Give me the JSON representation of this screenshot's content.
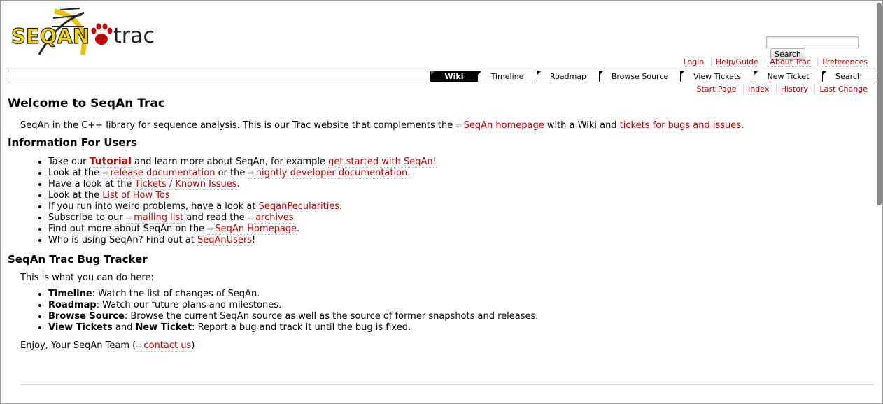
{
  "logo": {
    "text_seqan": "SEQAN",
    "text_trac": "trac"
  },
  "search": {
    "button_label": "Search",
    "placeholder": ""
  },
  "metanav": [
    "Login",
    "Help/Guide",
    "About Trac",
    "Preferences"
  ],
  "mainnav": [
    {
      "label": "Wiki",
      "active": true
    },
    {
      "label": "Timeline"
    },
    {
      "label": "Roadmap"
    },
    {
      "label": "Browse Source"
    },
    {
      "label": "View Tickets"
    },
    {
      "label": "New Ticket"
    },
    {
      "label": "Search"
    }
  ],
  "ctxtnav": [
    "Start Page",
    "Index",
    "History",
    "Last Change"
  ],
  "page": {
    "title": "Welcome to SeqAn Trac",
    "intro": {
      "t1": "SeqAn in the C++ library for sequence analysis. This is our Trac website that complements the ",
      "link1": "SeqAn homepage",
      "t2": " with a Wiki and ",
      "link2": "tickets for bugs and issues",
      "t3": "."
    },
    "users_heading": "Information For Users",
    "users": {
      "i1": {
        "a": "Take our ",
        "b": "Tutorial",
        "c": " and learn more about SeqAn, for example ",
        "d": "get started with SeqAn!"
      },
      "i2": {
        "a": "Look at the ",
        "b": "release documentation",
        "c": " or the ",
        "d": "nightly developer documentation",
        "e": "."
      },
      "i3": {
        "a": "Have a look at the ",
        "b": "Tickets / Known Issues",
        "c": "."
      },
      "i4": {
        "a": "Look at the ",
        "b": "List of How Tos"
      },
      "i5": {
        "a": "If you run into weird problems, have a look at ",
        "b": "SeqanPecularities",
        "c": "."
      },
      "i6": {
        "a": "Subscribe to our ",
        "b": "mailing list",
        "c": " and read the ",
        "d": "archives"
      },
      "i7": {
        "a": "Find out more about SeqAn on the ",
        "b": "SeqAn Homepage",
        "c": "."
      },
      "i8": {
        "a": "Who is using SeqAn? Find out at ",
        "b": "SeqAnUsers",
        "c": "!"
      }
    },
    "tracker_heading": "SeqAn Trac Bug Tracker",
    "tracker_intro": "This is what you can do here:",
    "tracker": {
      "i1": {
        "a": "Timeline",
        "b": ": Watch the list of changes of SeqAn."
      },
      "i2": {
        "a": "Roadmap",
        "b": ": Watch our future plans and milestones."
      },
      "i3": {
        "a": "Browse Source",
        "b": ": Browse the current SeqAn source as well as the source of former snapshots and releases."
      },
      "i4": {
        "a": "View Tickets",
        "b": " and ",
        "c": "New Ticket",
        "d": ": Report a bug and track it until the bug is fixed."
      }
    },
    "closing": {
      "a": "Enjoy, Your SeqAn Team (",
      "b": "contact us",
      "c": ")"
    }
  }
}
